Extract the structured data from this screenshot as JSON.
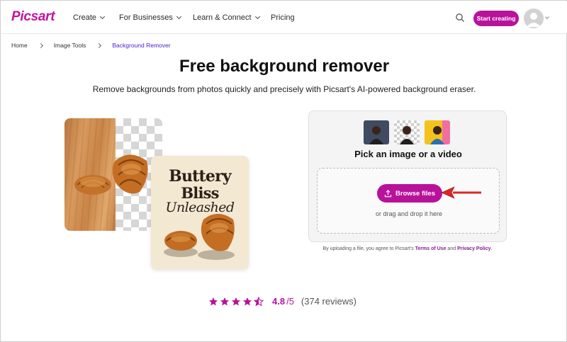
{
  "brand": {
    "logo_text": "Picsart",
    "accent": "#b8129b"
  },
  "header": {
    "nav": [
      {
        "label": "Create",
        "has_dropdown": true
      },
      {
        "label": "For Businesses",
        "has_dropdown": true
      },
      {
        "label": "Learn & Connect",
        "has_dropdown": true
      },
      {
        "label": "Pricing",
        "has_dropdown": false
      }
    ],
    "search_icon": "search-icon",
    "start_label": "Start creating",
    "avatar_icon": "user-avatar-icon"
  },
  "breadcrumb": {
    "items": [
      "Home",
      "Image Tools",
      "Background Remover"
    ]
  },
  "hero": {
    "title": "Free background remover",
    "subtitle": "Remove backgrounds from photos quickly and precisely with Picsart's AI-powered background eraser."
  },
  "illustration": {
    "poster_lines": [
      "Buttery",
      "Bliss",
      "Unleashed"
    ]
  },
  "upload": {
    "pick_title": "Pick an image or a video",
    "browse_label": "Browse files",
    "drag_text": "or drag and drop it here",
    "legal_prefix": "By uploading a file, you agree to Picsart's ",
    "terms_label": "Terms of Use",
    "legal_and": " and ",
    "privacy_label": "Privacy Policy",
    "legal_suffix": "."
  },
  "rating": {
    "stars": 4.5,
    "score": "4.8",
    "max": "/5",
    "reviews": "(374 reviews)"
  }
}
